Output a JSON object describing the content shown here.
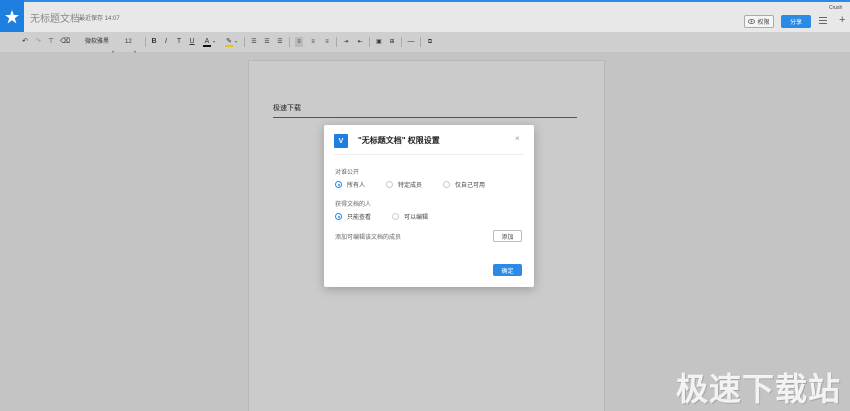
{
  "header": {
    "doc_title": "无标题文档",
    "save_status": "最近保存 14:07",
    "permission_label": "权限",
    "share_label": "分享",
    "user_name": "Crush"
  },
  "toolbar": {
    "font_family": "微软雅黑",
    "font_size": "12",
    "bold": "B",
    "italic": "I",
    "underline": "U",
    "strike": "T",
    "font_color": "A"
  },
  "document": {
    "heading": "极速下载"
  },
  "dialog": {
    "logo_text": "V",
    "title": "\"无标题文档\" 权限设置",
    "close": "×",
    "section_public": "对谁公开",
    "public_options": [
      {
        "label": "所有人",
        "checked": true
      },
      {
        "label": "特定成员",
        "checked": false
      },
      {
        "label": "仅自己可用",
        "checked": false
      }
    ],
    "section_access": "获得文档的人",
    "access_options": [
      {
        "label": "只能查看",
        "checked": true
      },
      {
        "label": "可以编辑",
        "checked": false
      }
    ],
    "add_members_label": "添加可编辑该文档的成员",
    "add_button": "添加",
    "confirm_button": "确定"
  },
  "watermark": "极速下载站",
  "colors": {
    "accent": "#2b8ae6",
    "background": "#c4c4c4"
  }
}
